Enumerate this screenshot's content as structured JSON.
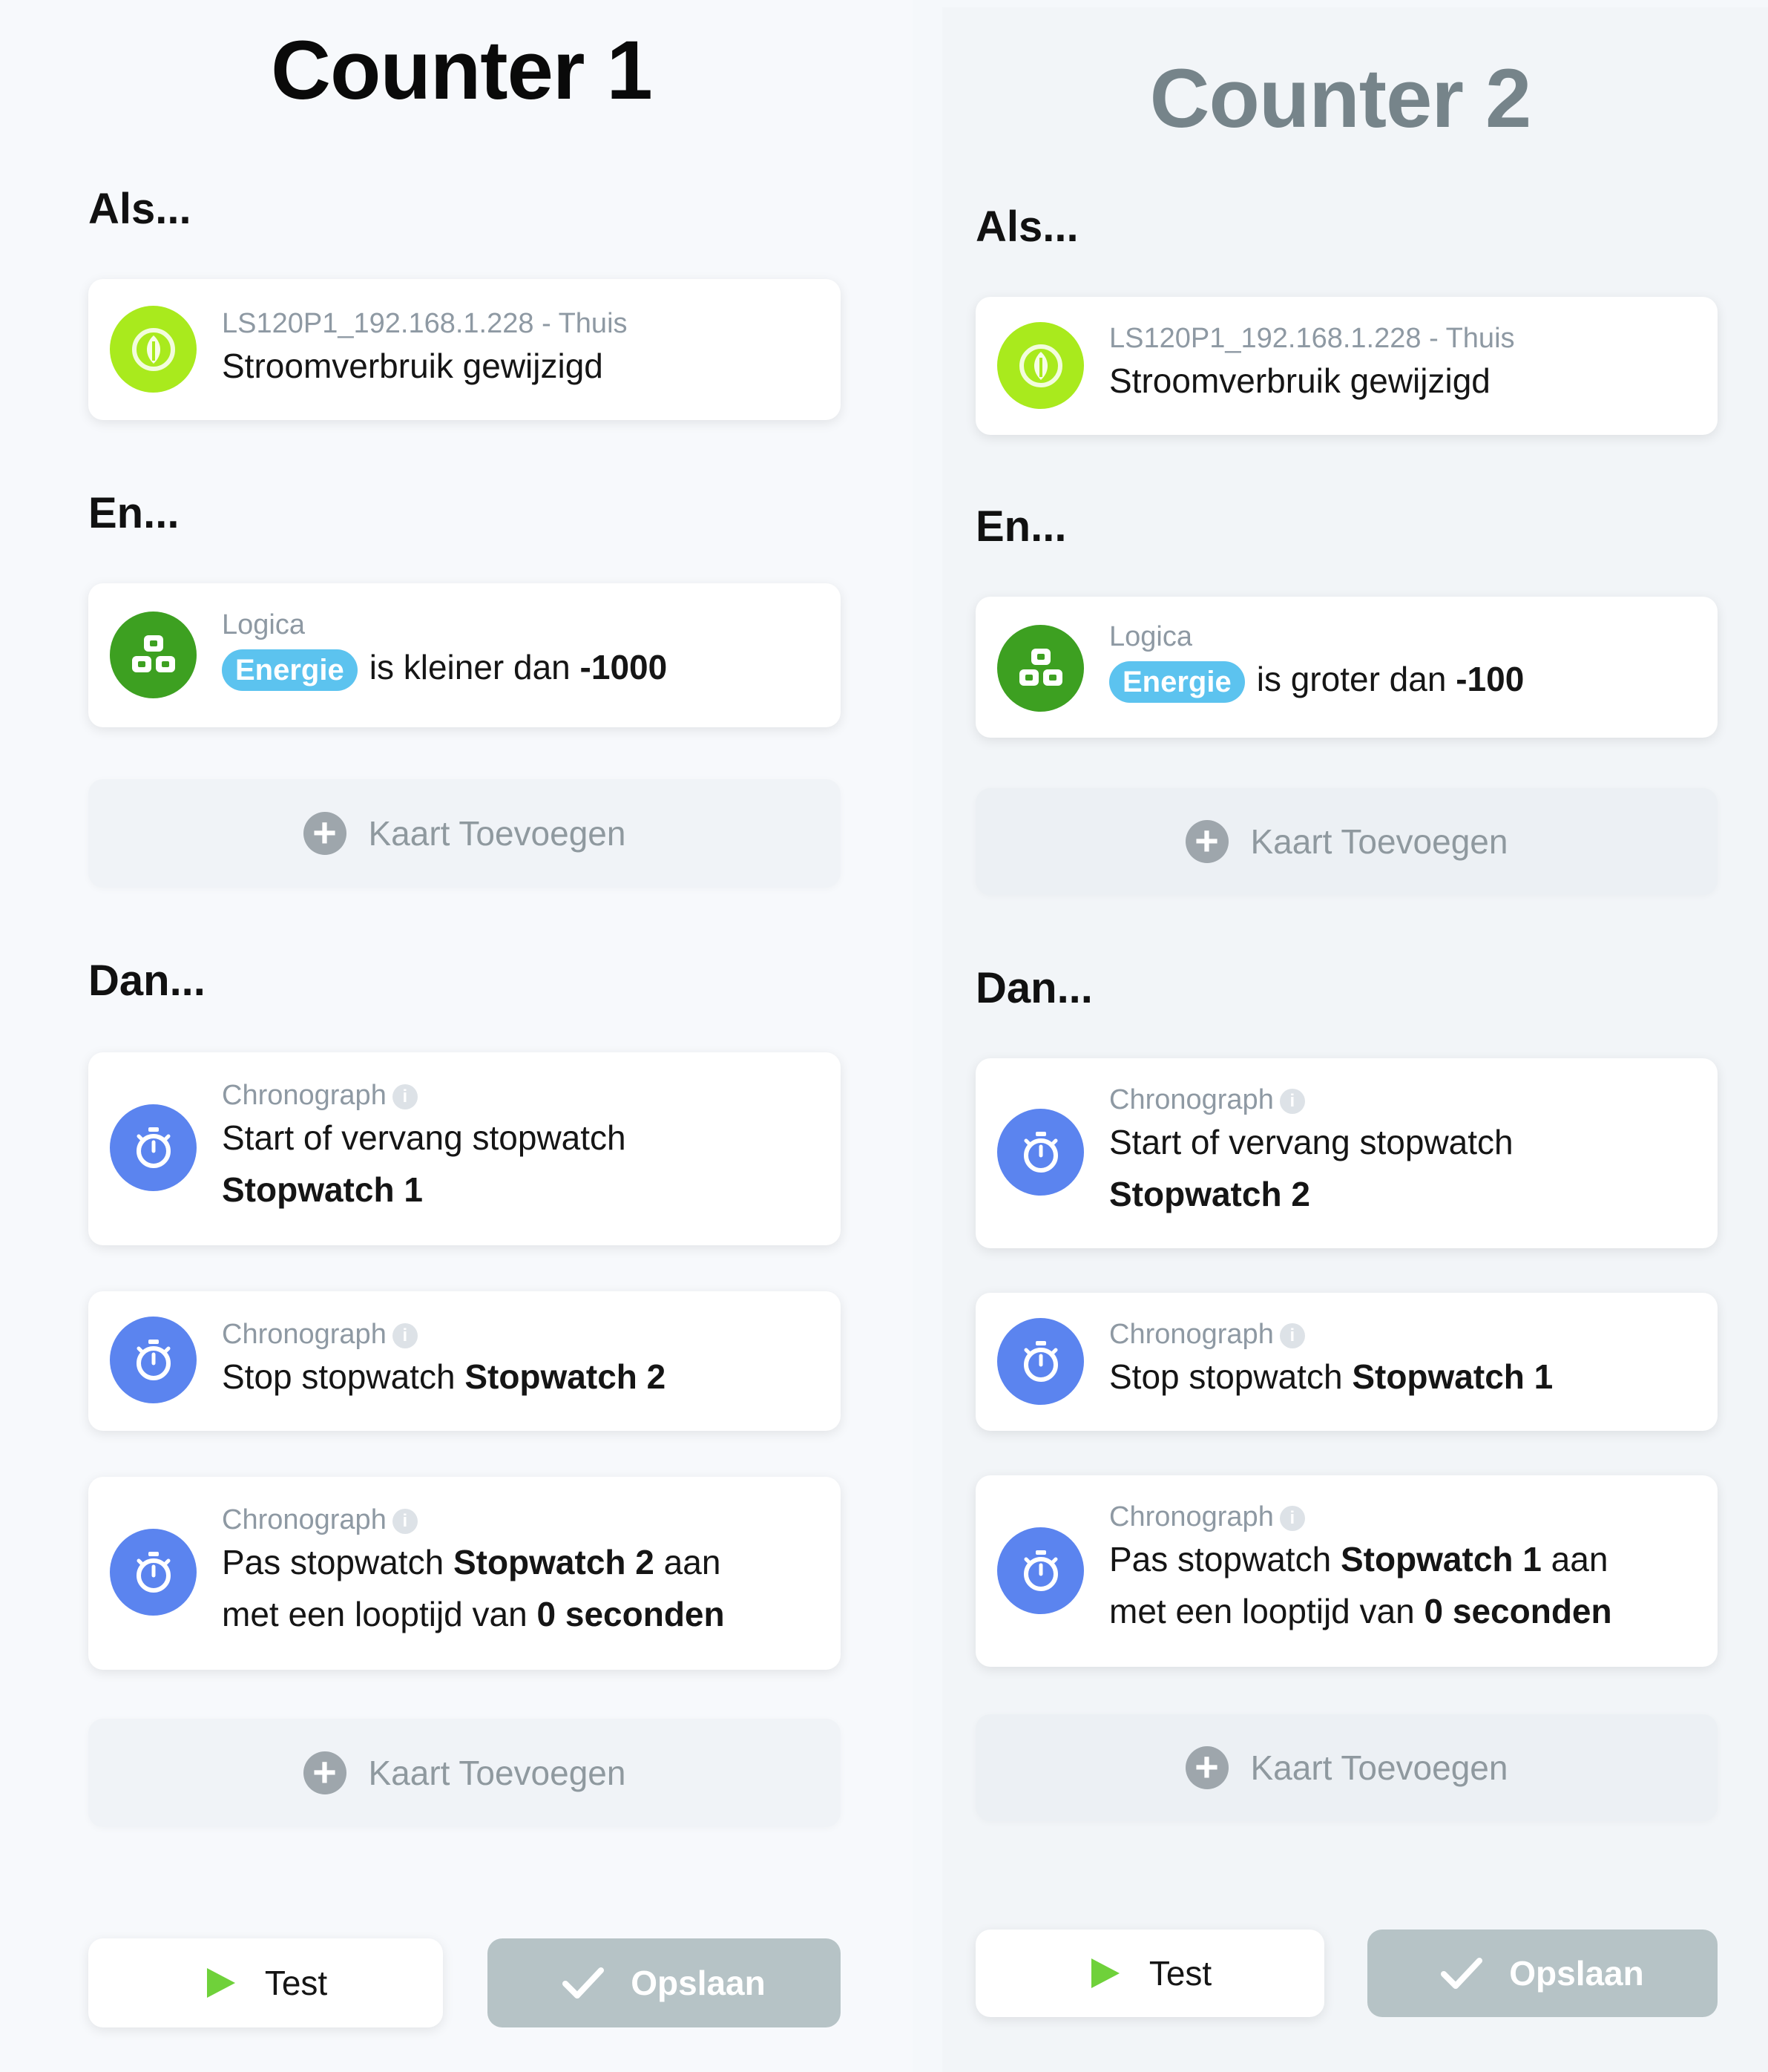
{
  "counters": [
    {
      "title": "Counter 1",
      "when_label": "Als...",
      "and_label": "En...",
      "then_label": "Dan...",
      "trigger": {
        "device": "LS120P1_192.168.1.228 - Thuis",
        "text": "Stroomverbruik gewijzigd"
      },
      "condition": {
        "source": "Logica",
        "tag": "Energie",
        "operator": "is kleiner dan",
        "value": "-1000"
      },
      "add_card_label": "Kaart Toevoegen",
      "actions": [
        {
          "source": "Chronograph",
          "line1": "Start of vervang stopwatch",
          "name": "Stopwatch 1"
        },
        {
          "source": "Chronograph",
          "text": "Stop stopwatch",
          "name": "Stopwatch 2"
        },
        {
          "source": "Chronograph",
          "pre": "Pas stopwatch",
          "name": "Stopwatch 2",
          "post": "aan",
          "line2_pre": "met een looptijd van",
          "value": "0",
          "unit": "seconden"
        }
      ],
      "test_label": "Test",
      "save_label": "Opslaan"
    },
    {
      "title": "Counter 2",
      "when_label": "Als...",
      "and_label": "En...",
      "then_label": "Dan...",
      "trigger": {
        "device": "LS120P1_192.168.1.228 - Thuis",
        "text": "Stroomverbruik gewijzigd"
      },
      "condition": {
        "source": "Logica",
        "tag": "Energie",
        "operator": "is groter dan",
        "value": "-100"
      },
      "add_card_label": "Kaart Toevoegen",
      "actions": [
        {
          "source": "Chronograph",
          "line1": "Start of vervang stopwatch",
          "name": "Stopwatch 2"
        },
        {
          "source": "Chronograph",
          "text": "Stop stopwatch",
          "name": "Stopwatch 1"
        },
        {
          "source": "Chronograph",
          "pre": "Pas stopwatch",
          "name": "Stopwatch 1",
          "post": "aan",
          "line2_pre": "met een looptijd van",
          "value": "0",
          "unit": "seconden"
        }
      ],
      "test_label": "Test",
      "save_label": "Opslaan"
    }
  ],
  "icons": {
    "trigger": "leaf-power-icon",
    "condition": "logic-blocks-icon",
    "action": "stopwatch-icon",
    "info": "info-icon",
    "add": "plus-circle-icon",
    "test": "play-icon",
    "save": "check-icon"
  },
  "colors": {
    "trigger_icon_bg": "#a9ea1d",
    "condition_icon_bg": "#3da021",
    "action_icon_bg": "#5b84ef",
    "tag_bg": "#5cc3ef",
    "play": "#6fd13a",
    "save_bg": "#b6c3c6"
  }
}
